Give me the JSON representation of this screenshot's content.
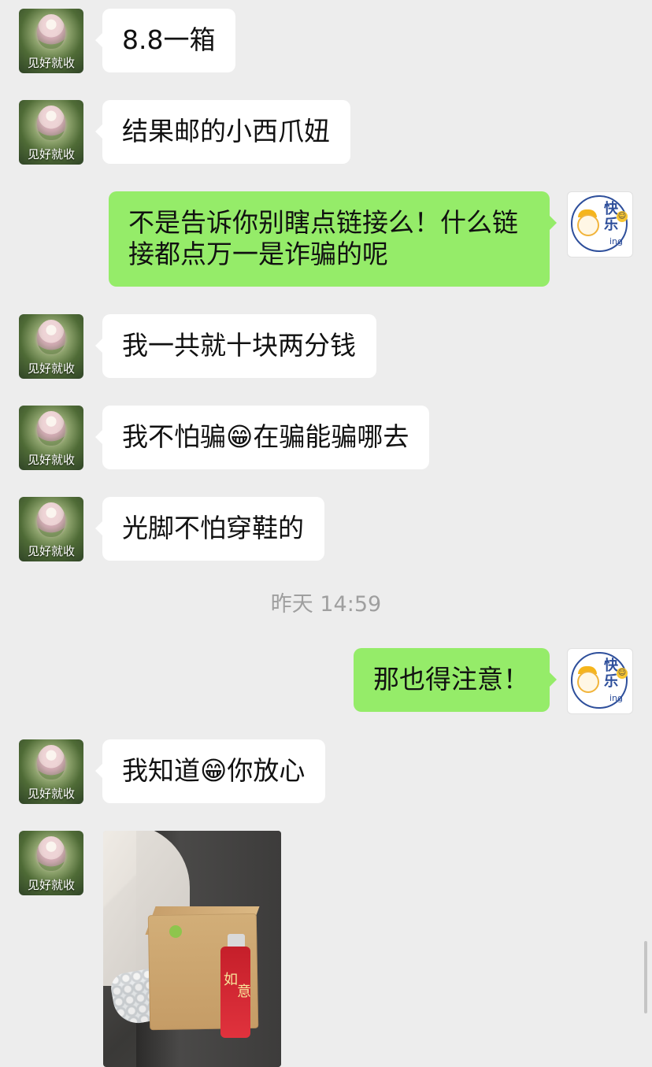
{
  "contacts": {
    "left_avatar_caption": "见好就收",
    "right_avatar_text": "快乐",
    "right_avatar_small": "ing"
  },
  "messages": [
    {
      "side": "left",
      "text": "8.8一箱"
    },
    {
      "side": "left",
      "text": "结果邮的小西爪妞"
    },
    {
      "side": "right",
      "text": "不是告诉你别瞎点链接么！什么链\n接都点万一是诈骗的呢"
    },
    {
      "side": "left",
      "text": "我一共就十块两分钱"
    },
    {
      "side": "left",
      "text": "我不怕骗😁在骗能骗哪去"
    },
    {
      "side": "left",
      "text": "光脚不怕穿鞋的"
    },
    {
      "side": "right",
      "text": "那也得注意！"
    },
    {
      "side": "left",
      "text": "我知道😁你放心"
    }
  ],
  "timestamp": "昨天 14:59",
  "photo": {
    "label_1": "如",
    "label_2": "意"
  }
}
